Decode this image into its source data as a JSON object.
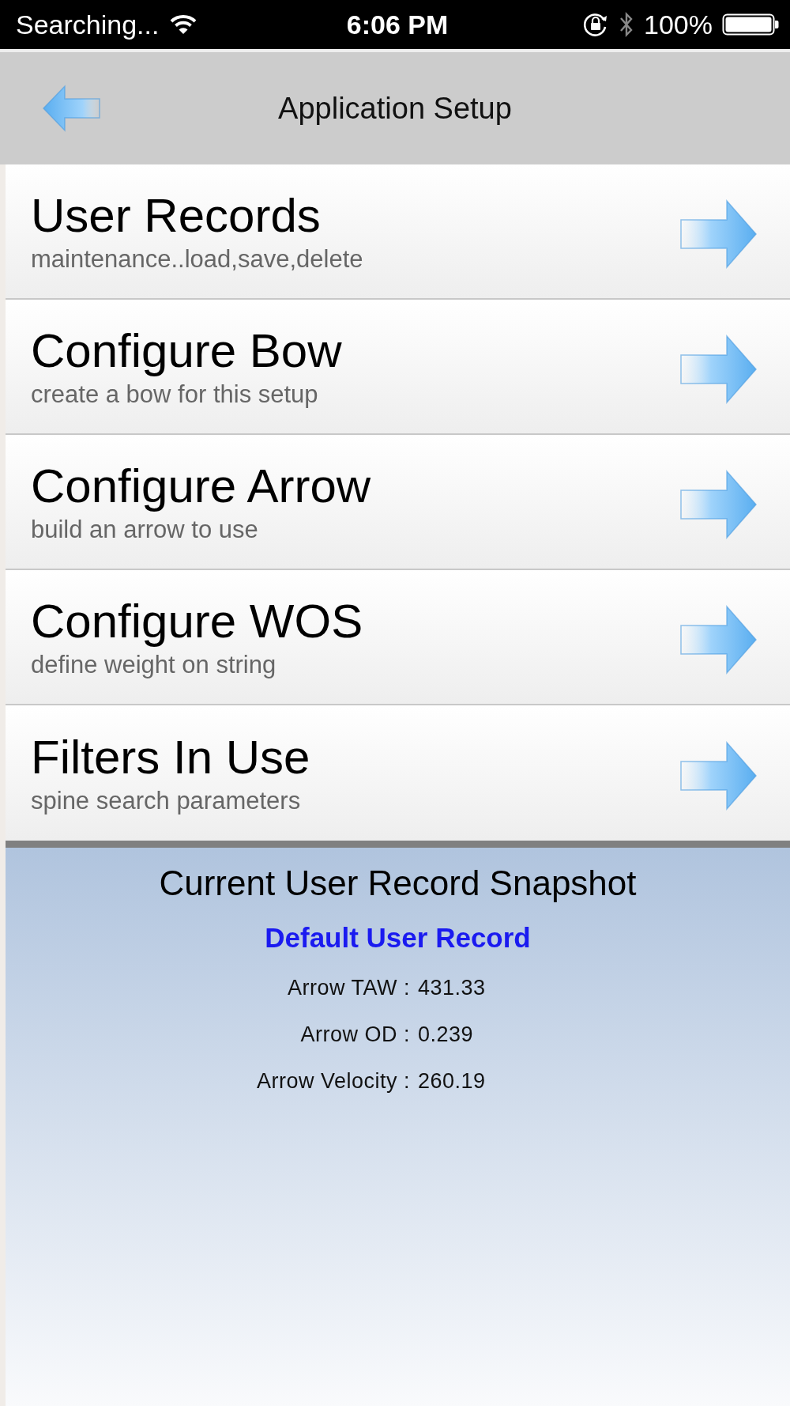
{
  "status_bar": {
    "carrier": "Searching...",
    "time": "6:06 PM",
    "battery": "100%"
  },
  "nav_bar": {
    "title": "Application Setup"
  },
  "menu": [
    {
      "title": "User Records",
      "subtitle": "maintenance..load,save,delete"
    },
    {
      "title": "Configure Bow",
      "subtitle": "create a bow for this setup"
    },
    {
      "title": "Configure Arrow",
      "subtitle": "build an arrow to use"
    },
    {
      "title": "Configure WOS",
      "subtitle": "define weight on string"
    },
    {
      "title": "Filters In Use",
      "subtitle": "spine search parameters"
    }
  ],
  "snapshot": {
    "title": "Current User Record Snapshot",
    "record": "Default User Record",
    "fields": [
      {
        "label": "Arrow TAW :",
        "value": "431.33"
      },
      {
        "label": "Arrow OD :",
        "value": "0.239"
      },
      {
        "label": "Arrow Velocity :",
        "value": "260.19"
      }
    ]
  }
}
